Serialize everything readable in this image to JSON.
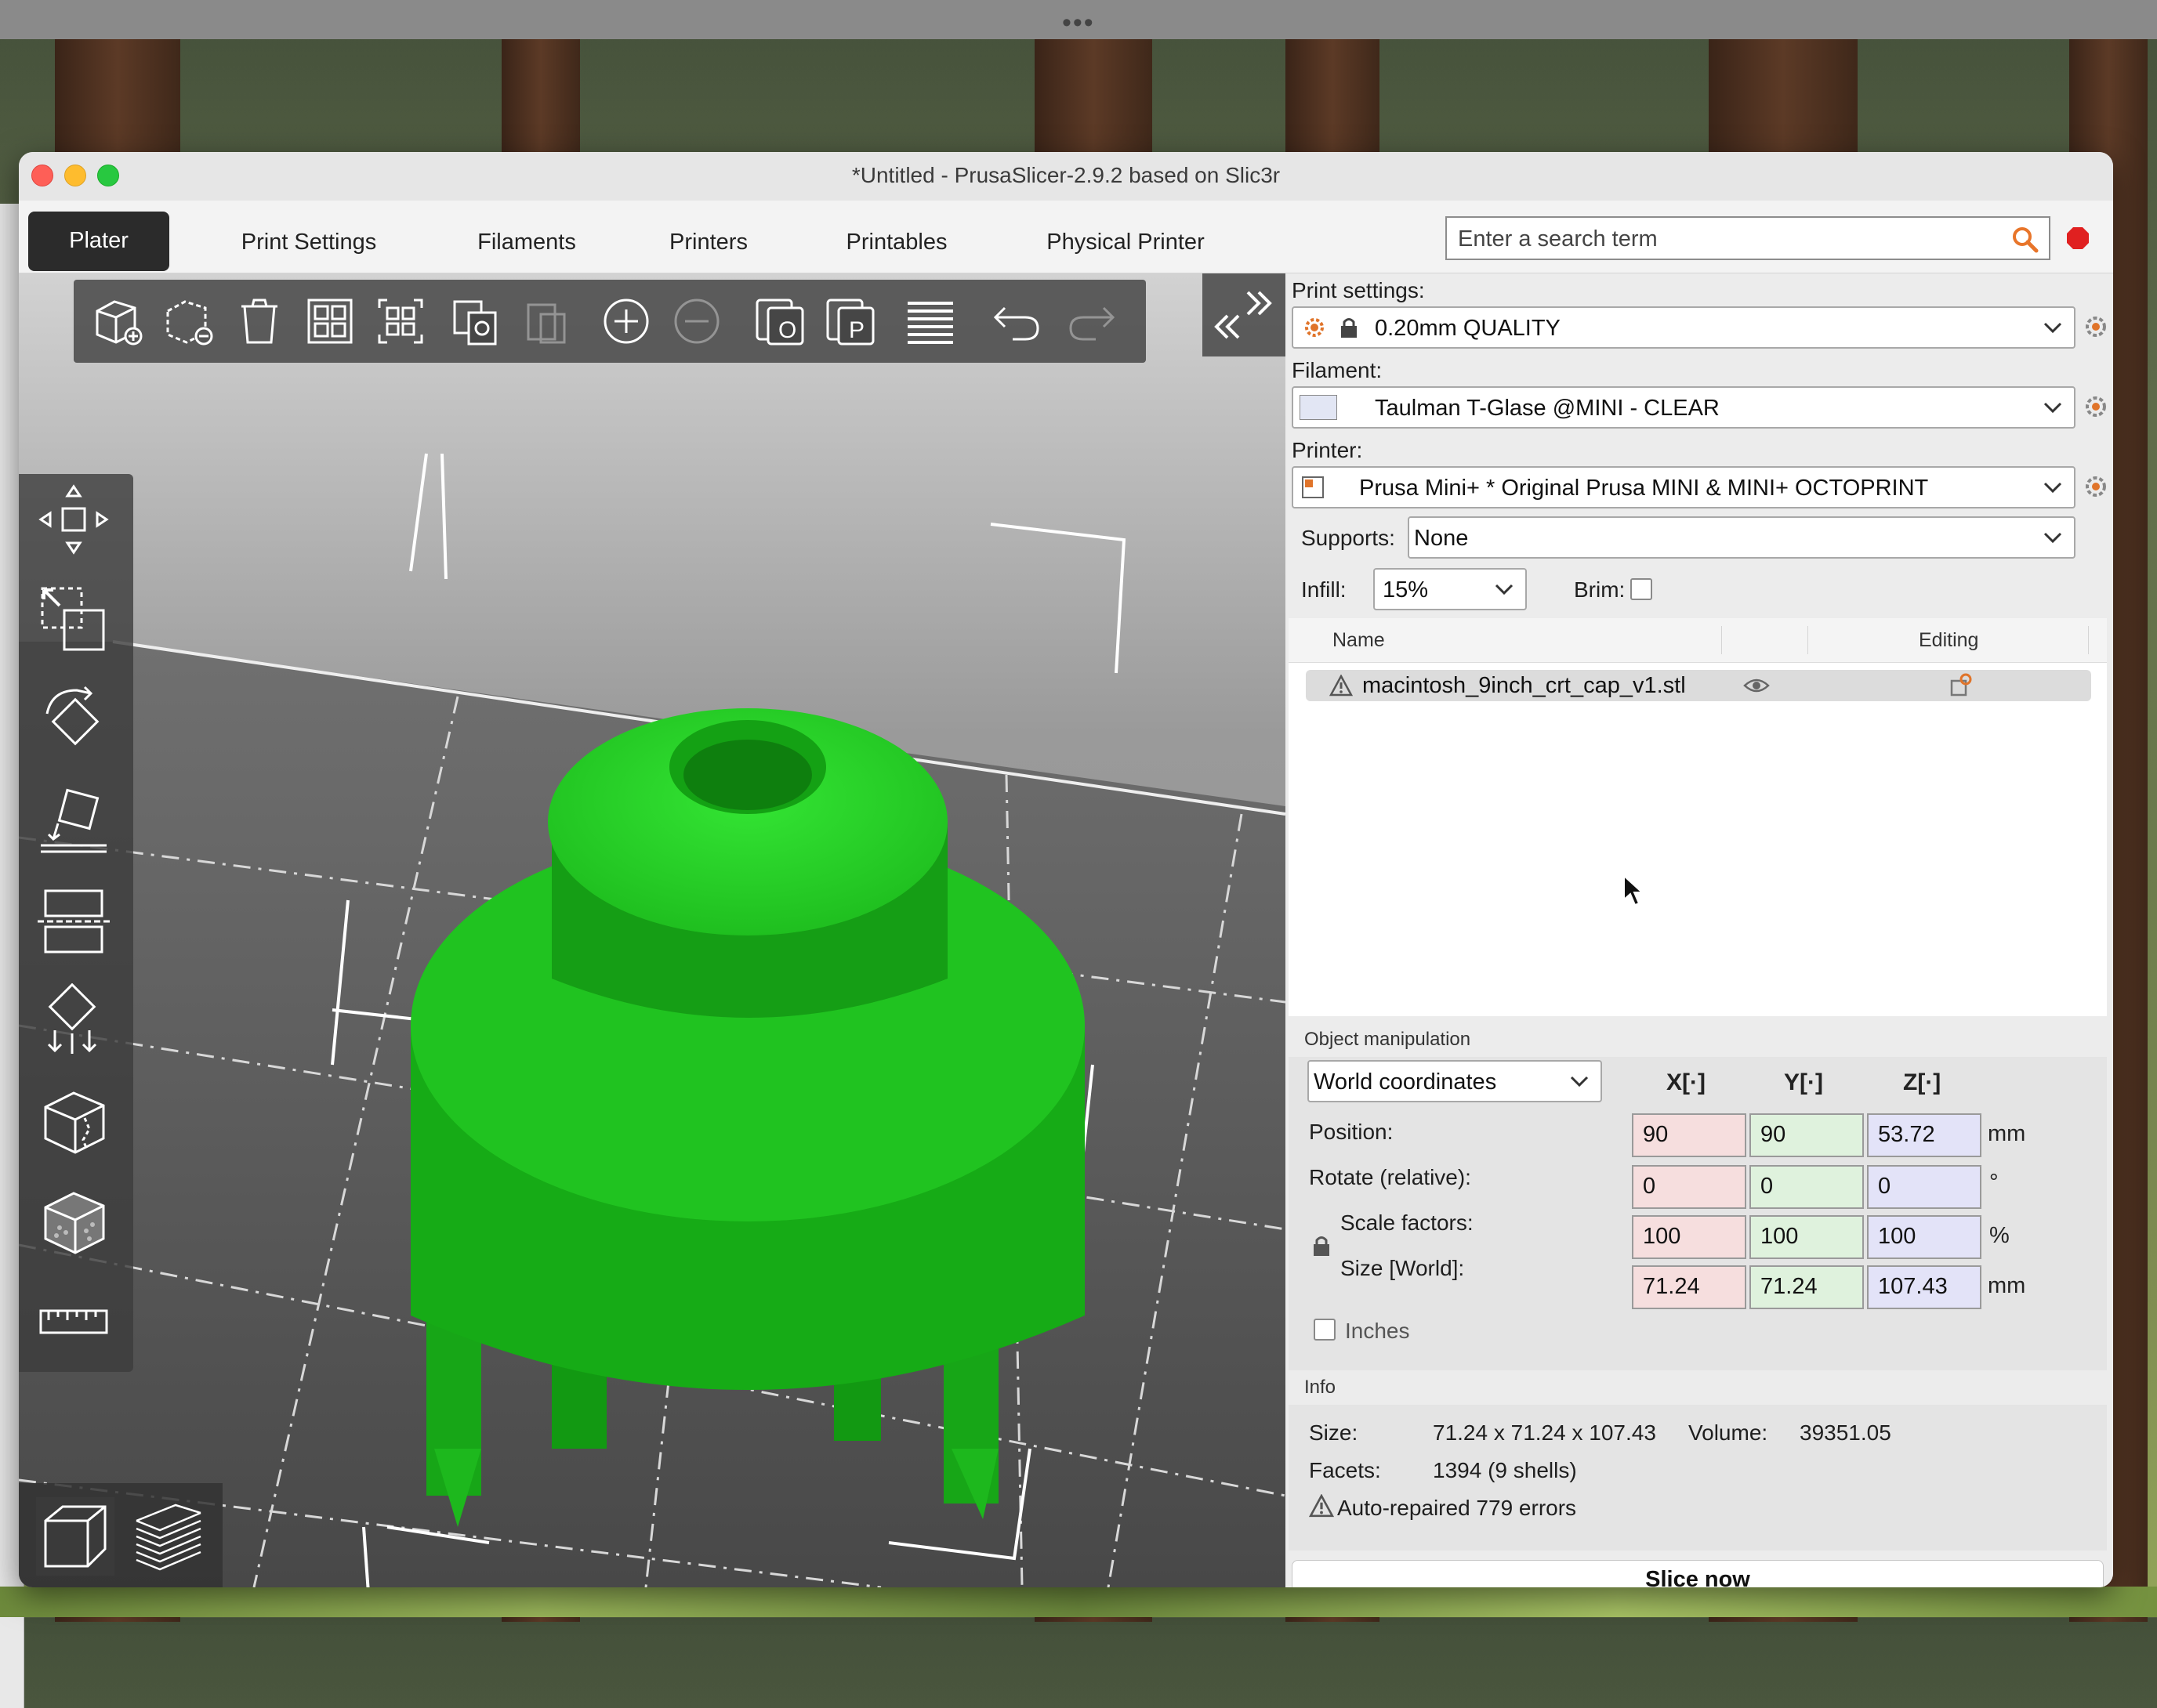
{
  "window": {
    "title": "*Untitled - PrusaSlicer-2.9.2 based on Slic3r"
  },
  "tabs": [
    "Plater",
    "Print Settings",
    "Filaments",
    "Printers",
    "Printables",
    "Physical Printer"
  ],
  "search": {
    "placeholder": "Enter a search term"
  },
  "sidebar": {
    "print_settings_label": "Print settings:",
    "print_settings_value": "0.20mm QUALITY",
    "filament_label": "Filament:",
    "filament_value": "Taulman T-Glase @MINI - CLEAR",
    "printer_label": "Printer:",
    "printer_value": "Prusa Mini+ * Original Prusa MINI & MINI+ OCTOPRINT",
    "supports_label": "Supports:",
    "supports_value": "None",
    "infill_label": "Infill:",
    "infill_value": "15%",
    "brim_label": "Brim:",
    "brim_checked": false
  },
  "object_list": {
    "columns": {
      "name": "Name",
      "editing": "Editing"
    },
    "items": [
      {
        "name": "macintosh_9inch_crt_cap_v1.stl",
        "warning": true,
        "visible": true
      }
    ]
  },
  "object_manipulation": {
    "title": "Object manipulation",
    "coordinates": "World coordinates",
    "axes": [
      "X",
      "Y",
      "Z"
    ],
    "rows": {
      "position": {
        "label": "Position:",
        "values": [
          "90",
          "90",
          "53.72"
        ],
        "unit": "mm"
      },
      "rotate": {
        "label": "Rotate (relative):",
        "values": [
          "0",
          "0",
          "0"
        ],
        "unit": "°"
      },
      "scale": {
        "label": "Scale factors:",
        "values": [
          "100",
          "100",
          "100"
        ],
        "unit": "%"
      },
      "size": {
        "label": "Size [World]:",
        "values": [
          "71.24",
          "71.24",
          "107.43"
        ],
        "unit": "mm"
      }
    },
    "inches_label": "Inches",
    "inches_checked": false
  },
  "info": {
    "title": "Info",
    "size_label": "Size:",
    "size_value": "71.24 x 71.24 x 107.43",
    "volume_label": "Volume:",
    "volume_value": "39351.05",
    "facets_label": "Facets:",
    "facets_value": "1394 (9 shells)",
    "warning": "Auto-repaired 779 errors"
  },
  "slice_button": "Slice now",
  "colors": {
    "model": "#1fc81f",
    "accent_active_tab": "#2b2b2b",
    "stop": "#e02020"
  }
}
